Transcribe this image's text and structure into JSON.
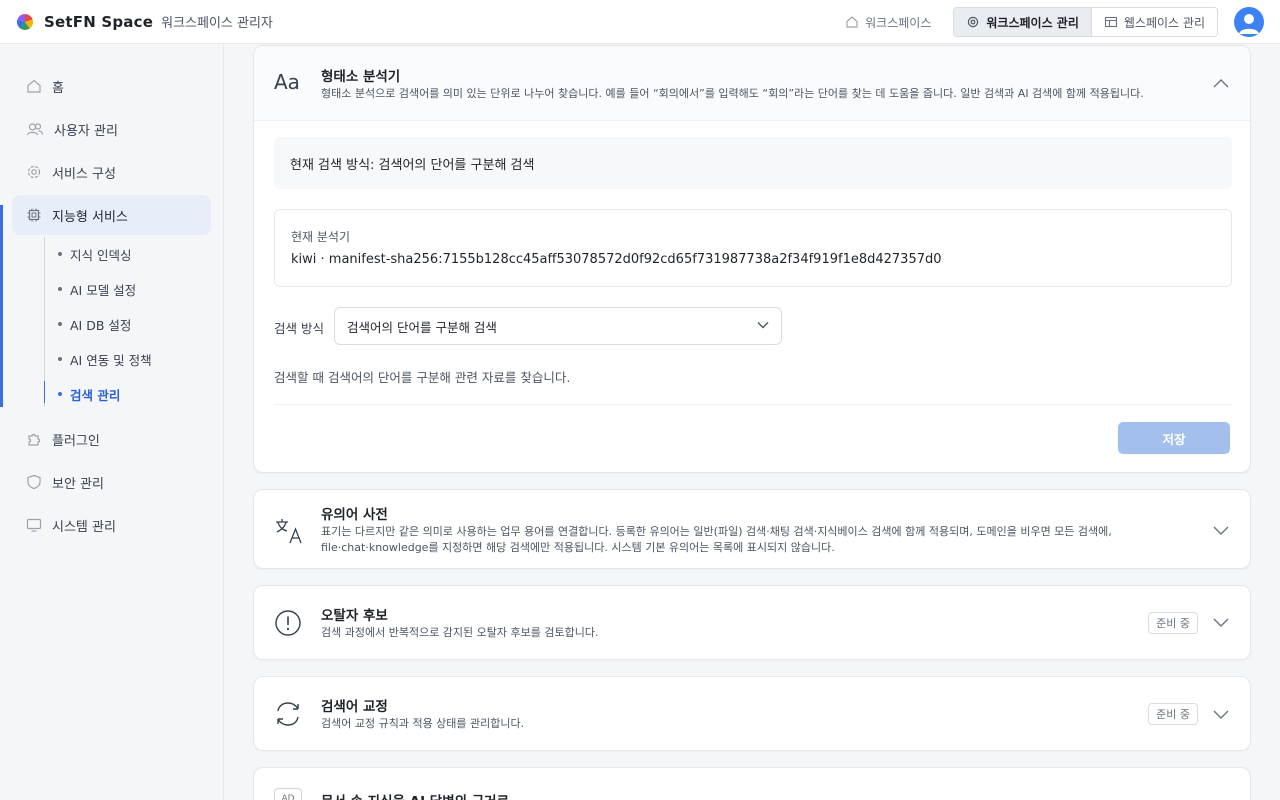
{
  "brand": {
    "name": "SetFN Space",
    "subtitle": "워크스페이스 관리자"
  },
  "topnav": {
    "workspace_link": "워크스페이스",
    "workspace_admin": "워크스페이스 관리",
    "webspace_admin": "웹스페이스 관리"
  },
  "sidebar": {
    "items": [
      {
        "label": "홈",
        "icon": "home-icon"
      },
      {
        "label": "사용자 관리",
        "icon": "users-icon"
      },
      {
        "label": "서비스 구성",
        "icon": "gear-icon"
      },
      {
        "label": "지능형 서비스",
        "icon": "chip-icon"
      },
      {
        "label": "플러그인",
        "icon": "puzzle-icon"
      },
      {
        "label": "보안 관리",
        "icon": "shield-icon"
      },
      {
        "label": "시스템 관리",
        "icon": "monitor-icon"
      }
    ],
    "subitems": [
      {
        "label": "지식 인덱싱"
      },
      {
        "label": "AI 모델 설정"
      },
      {
        "label": "AI DB 설정"
      },
      {
        "label": "AI 연동 및 정책"
      },
      {
        "label": "검색 관리"
      }
    ]
  },
  "morph": {
    "icon_text": "Aa",
    "title": "형태소 분석기",
    "desc": "형태소 분석으로 검색어를 의미 있는 단위로 나누어 찾습니다. 예를 들어 “회의에서”를 입력해도 “회의”라는 단어를 찾는 데 도움을 줍니다. 일반 검색과 AI 검색에 함께 적용됩니다.",
    "current_mode": "현재 검색 방식: 검색어의 단어를 구분해 검색",
    "analyzer_label": "현재 분석기",
    "analyzer_value": "kiwi · manifest-sha256:7155b128cc45aff53078572d0f92cd65f731987738a2f34f919f1e8d427357d0",
    "field_label": "검색 방식",
    "select_value": "검색어의 단어를 구분해 검색",
    "help": "검색할 때 검색어의 단어를 구분해 관련 자료를 찾습니다.",
    "save": "저장"
  },
  "synonym": {
    "title": "유의어 사전",
    "desc1": "표기는 다르지만 같은 의미로 사용하는 업무 용어를 연결합니다. 등록한 유의어는 일반(파일) 검색·채팅 검색·지식베이스 검색에 함께 적용되며, 도메인을 비우면 모든 검색에,",
    "desc2": "file·chat·knowledge를 지정하면 해당 검색에만 적용됩니다. 시스템 기본 유의어는 목록에 표시되지 않습니다."
  },
  "typo": {
    "title": "오탈자 후보",
    "desc": "검색 과정에서 반복적으로 감지된 오탈자 후보를 검토합니다.",
    "badge": "준비 중"
  },
  "correction": {
    "title": "검색어 교정",
    "desc": "검색어 교정 규칙과 적용 상태를 관리합니다.",
    "badge": "준비 중"
  },
  "doc": {
    "icon_text": "AD",
    "title": "문서 속 지식을 AI 답변의 근거로"
  },
  "colors": {
    "accent": "#3b6fe0",
    "save_disabled": "#a3c0ec",
    "avatar": "#3b82f6"
  }
}
